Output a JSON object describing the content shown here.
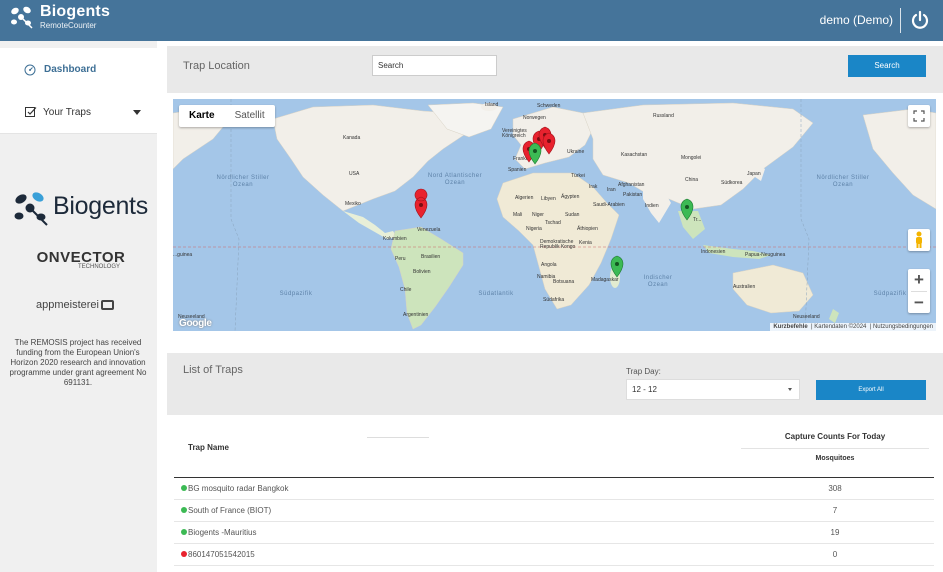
{
  "header": {
    "brand_name": "Biogents",
    "brand_sub": "RemoteCounter",
    "user_label": "demo (Demo)",
    "power_icon": "power-icon",
    "bg_color": "#45749a"
  },
  "sidebar": {
    "dashboard_label": "Dashboard",
    "traps_label": "Your Traps",
    "logo_biogents": "Biogents",
    "logo_onvector": "ONVECTOR",
    "logo_onvector_sub": "TECHNOLOGY",
    "logo_appmeisterei": "appmeisterei",
    "funding_text": "The REMOSIS project has received funding from the European Union's Horizon 2020 research and innovation programme under grant agreement No 691131."
  },
  "trap_location": {
    "title": "Trap Location",
    "search_placeholder": "Search",
    "search_button": "Search"
  },
  "map": {
    "type_map": "Karte",
    "type_satellite": "Satellit",
    "google": "Google",
    "attr_shortcuts": "Kurzbefehle",
    "attr_data": "Kartendaten ©2024",
    "attr_terms": "Nutzungsbedingungen",
    "oceans": {
      "n_pacific_left": "Nördlicher Stiller Ozean",
      "n_atlantic": "Nord Atlantischer Ozean",
      "n_pacific_right": "Nördlicher Stiller Ozean",
      "indian": "Indischer Ozean",
      "s_pacific_left": "Südpazifik",
      "s_atlantic": "Südatlantik",
      "s_pacific_right": "Südpazifik"
    },
    "places": {
      "kanada": "Kanada",
      "usa": "USA",
      "mexiko": "Mexiko",
      "venezuela": "Venezuela",
      "kolumbien": "Kolumbien",
      "peru": "Peru",
      "brasilien": "Brasilien",
      "bolivien": "Bolivien",
      "chile": "Chile",
      "argentinien": "Argentinien",
      "island": "Island",
      "schweden": "Schweden",
      "norwegen": "Norwegen",
      "uk": "Vereinigtes Königreich",
      "frankreich": "Frankreich",
      "spanien": "Spanien",
      "ukraine": "Ukraine",
      "russland": "Russland",
      "kasachstan": "Kasachstan",
      "mongolei": "Mongolei",
      "china": "China",
      "japan": "Japan",
      "suedkorea": "Südkorea",
      "tuerkei": "Türkei",
      "irak": "Irak",
      "iran": "Iran",
      "afghanistan": "Afghanistan",
      "pakistan": "Pakistan",
      "indien": "Indien",
      "algerien": "Algerien",
      "libyen": "Libyen",
      "aegypten": "Ägypten",
      "saudi": "Saudi-Arabien",
      "mali": "Mali",
      "niger": "Niger",
      "tschad": "Tschad",
      "sudan": "Sudan",
      "nigeria": "Nigeria",
      "aethiopien": "Äthiopien",
      "kongo": "Demokratische Republik Kongo",
      "kenia": "Kenia",
      "angola": "Angola",
      "namibia": "Namibia",
      "botsuana": "Botsuana",
      "madagaskar": "Madagaskar",
      "suedafrika": "Südafrika",
      "indonesien": "Indonesien",
      "papua": "Papua-Neuguinea",
      "australien": "Australien",
      "neuseeland": "Neuseeland",
      "neuseeland_left": "Neuseeland",
      "tt": "Tr...",
      "guinea": "...guinea"
    }
  },
  "list": {
    "title": "List of Traps",
    "trap_day_label": "Trap Day:",
    "trap_day_value": "12 - 12",
    "export_button": "Export All",
    "col_name": "Trap Name",
    "col_capture": "Capture Counts For Today",
    "col_mosquitoes": "Mosquitoes",
    "rows": [
      {
        "name": "BG mosquito radar Bangkok",
        "count": "308",
        "status": "green"
      },
      {
        "name": "South of France (BIOT)",
        "count": "7",
        "status": "green"
      },
      {
        "name": "Biogents -Mauritius",
        "count": "19",
        "status": "green"
      },
      {
        "name": "860147051542015",
        "count": "0",
        "status": "red"
      }
    ]
  },
  "colors": {
    "accent": "#1a86c7",
    "green": "#3cba54",
    "red": "#e8222e"
  }
}
